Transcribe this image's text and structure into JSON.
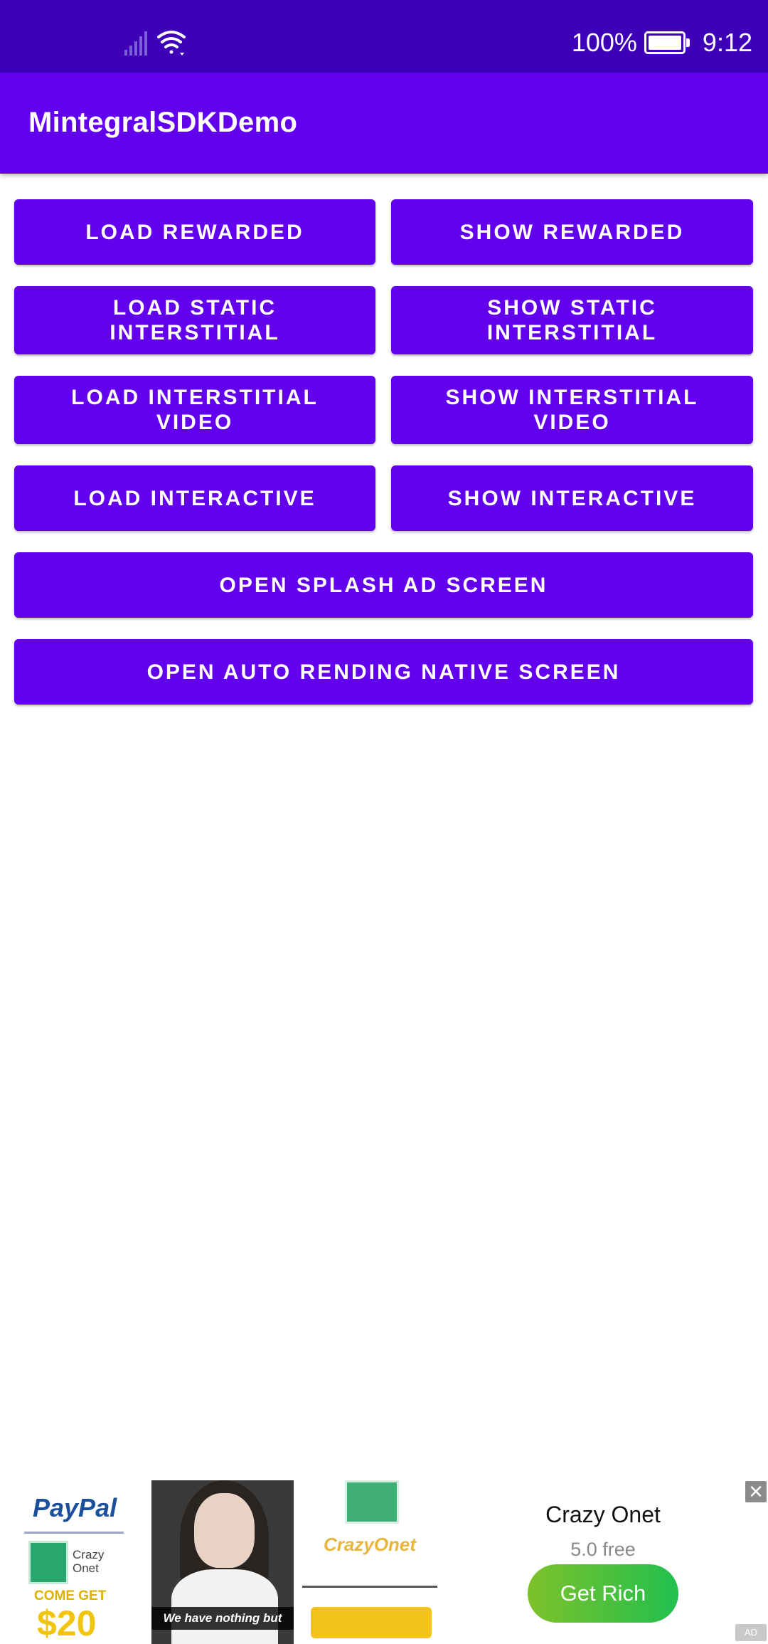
{
  "status_bar": {
    "battery_percent": "100%",
    "time": "9:12",
    "icons": [
      "signal-icon",
      "wifi-icon",
      "battery-icon"
    ]
  },
  "app_bar": {
    "title": "MintegralSDKDemo"
  },
  "buttons": {
    "load_rewarded": "LOAD REWARDED",
    "show_rewarded": "SHOW REWARDED",
    "load_static_interstitial": "LOAD STATIC INTERSTITIAL",
    "show_static_interstitial": "SHOW STATIC INTERSTITIAL",
    "load_interstitial_video": "LOAD INTERSTITIAL VIDEO",
    "show_interstitial_video": "SHOW INTERSTITIAL VIDEO",
    "load_interactive": "LOAD INTERACTIVE",
    "show_interactive": "SHOW INTERACTIVE",
    "open_splash": "OPEN SPLASH AD SCREEN",
    "open_auto_rending": "OPEN AUTO RENDING NATIVE SCREEN"
  },
  "ad": {
    "app_name": "Crazy Onet",
    "rating": "5.0 free",
    "cta": "Get Rich",
    "close_symbol": "✕",
    "label": "AD",
    "images": {
      "paypal_text": "PayPal",
      "crazy_onet_small": "Crazy Onet",
      "come_get": "COME GET",
      "amount": "$20",
      "photo_caption": "We have nothing but",
      "onet_title": "CrazyOnet"
    }
  },
  "colors": {
    "status_bar": "#3d00b8",
    "primary": "#6200ee",
    "cta_start": "#7ec12a",
    "cta_end": "#21c04e"
  }
}
